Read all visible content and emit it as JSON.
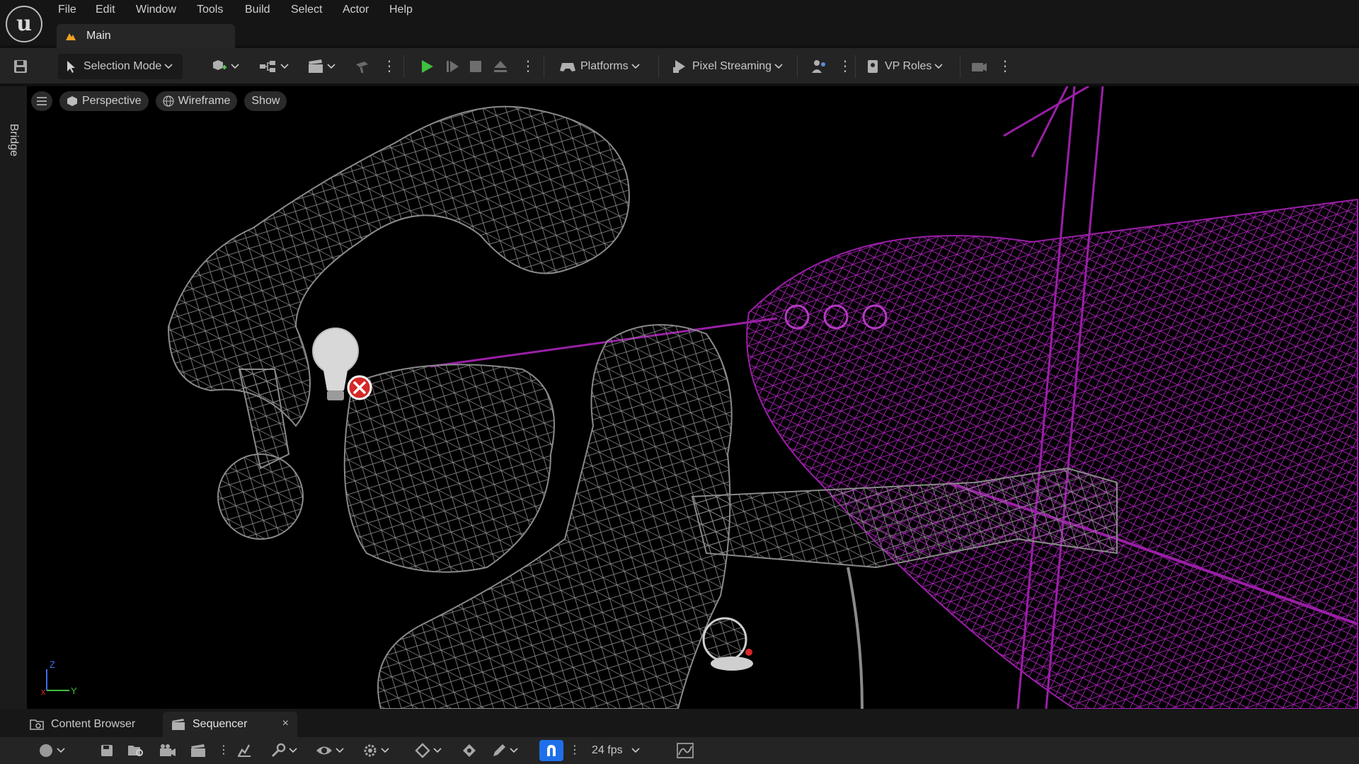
{
  "menu": {
    "items": [
      "File",
      "Edit",
      "Window",
      "Tools",
      "Build",
      "Select",
      "Actor",
      "Help"
    ]
  },
  "document_tab": {
    "label": "Main"
  },
  "toolbar": {
    "selection_mode": "Selection Mode",
    "platforms": "Platforms",
    "pixel_streaming": "Pixel Streaming",
    "vp_roles": "VP Roles"
  },
  "sidebar": {
    "bridge": "Bridge"
  },
  "viewport": {
    "perspective": "Perspective",
    "wireframe": "Wireframe",
    "show": "Show",
    "axis": {
      "z": "Z",
      "y": "Y",
      "x": "x"
    }
  },
  "bottom_tabs": {
    "content_browser": "Content Browser",
    "sequencer": "Sequencer",
    "close": "×"
  },
  "sequencer_toolbar": {
    "fps": "24 fps"
  },
  "colors": {
    "wireframe_grey": "#8a8a8a",
    "wireframe_purple": "#9a1fa6",
    "play_green": "#3fbf3f",
    "snap_blue": "#1f6feb",
    "error_red": "#d62828"
  }
}
